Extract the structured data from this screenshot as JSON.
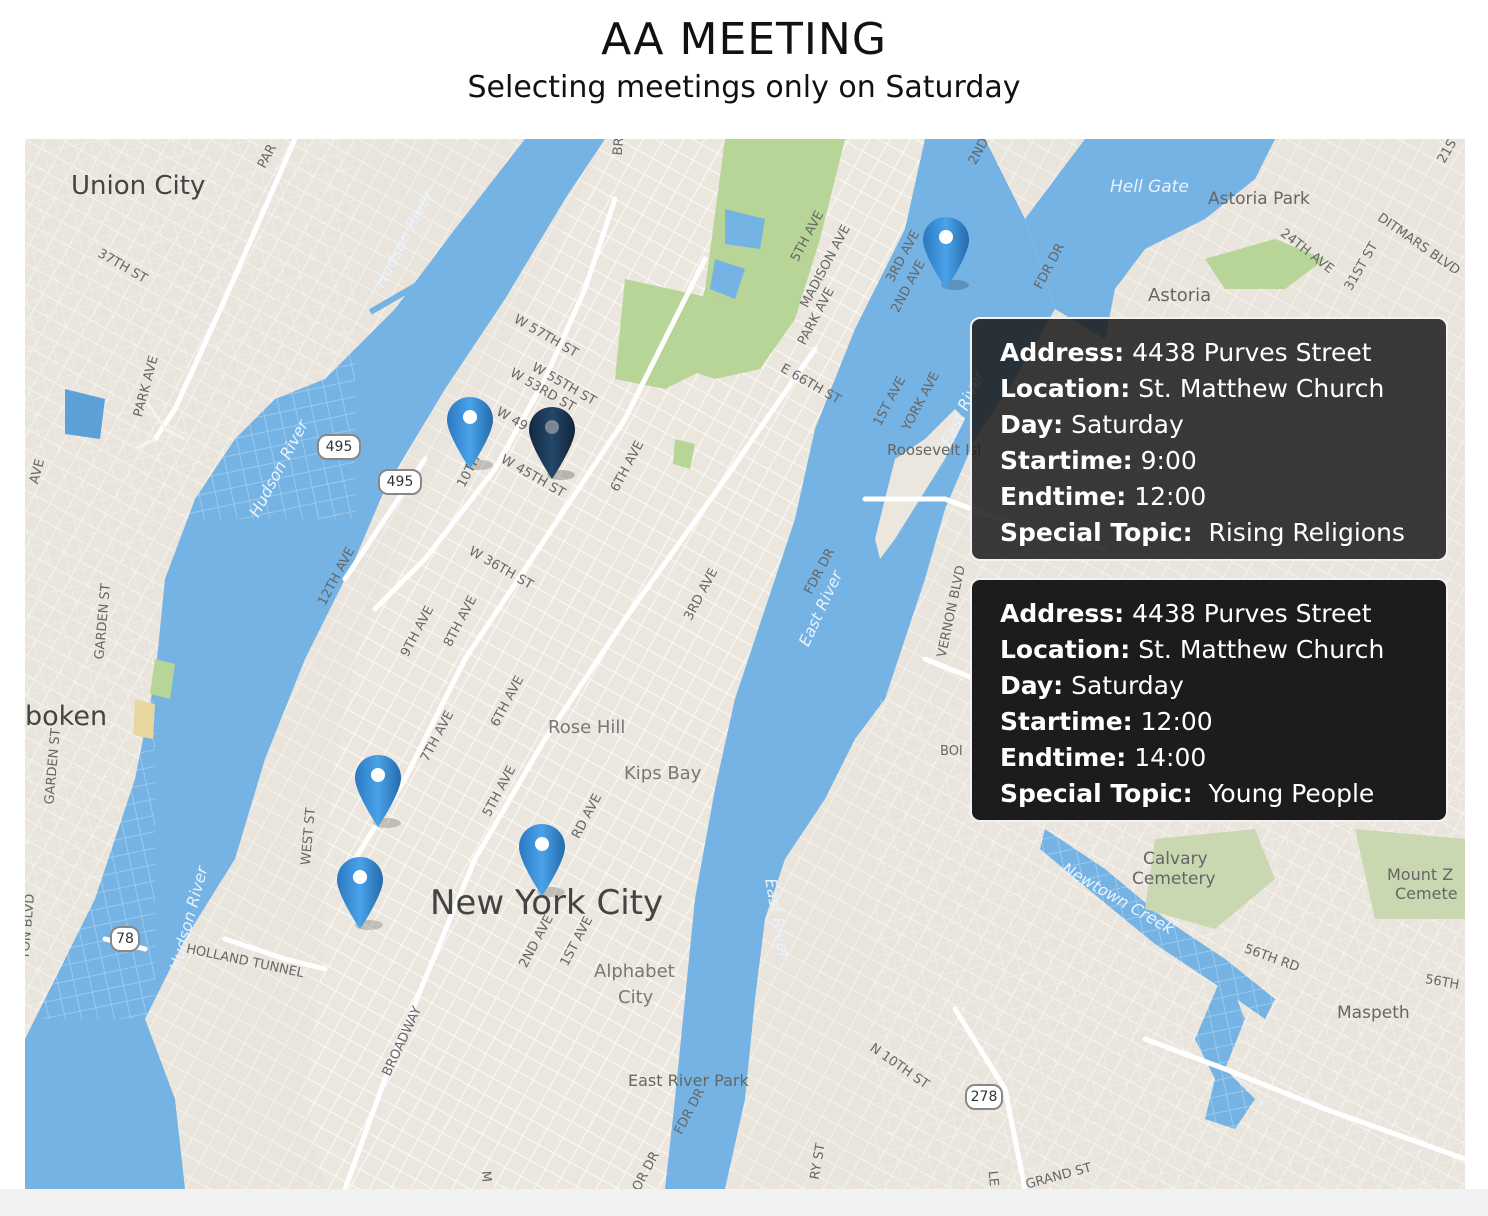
{
  "header": {
    "title": "AA MEETING",
    "subtitle": "Selecting meetings only on Saturday"
  },
  "map": {
    "place_labels": {
      "union_city": "Union City",
      "hoboken": "boken",
      "new_york_city": "New York City",
      "astoria": "Astoria",
      "astoria_park": "Astoria Park",
      "hell_gate": "Hell Gate",
      "roosevelt_island": "Roosevelt Isl",
      "rose_hill": "Rose Hill",
      "kips_bay": "Kips Bay",
      "alphabet_city_1": "Alphabet",
      "alphabet_city_2": "City",
      "calvary_1": "Calvary",
      "calvary_2": "Cemetery",
      "mount_z_1": "Mount Z",
      "mount_z_2": "Cemete",
      "maspeth": "Maspeth",
      "east_river_park": "East River Park"
    },
    "water_labels": {
      "hudson_1": "Hudson River",
      "hudson_2": "Hudson River",
      "hudson_3": "Hudson River",
      "east_river_1": "East River",
      "east_river_2": "East River",
      "east_river_3": "East River",
      "newtown_creek": "Newtown Creek"
    },
    "street_labels": {
      "w57": "W 57TH ST",
      "w55": "W 55TH ST",
      "w53": "W 53RD ST",
      "w49": "W 49",
      "w45": "W 45TH ST",
      "w36": "W 36TH ST",
      "e66": "E 66TH ST",
      "fifth_ave": "5TH AVE",
      "madison": "MADISON AVE",
      "park": "PARK AVE",
      "third_ave": "3RD AVE",
      "second_ave": "2ND AVE",
      "first_ave": "1ST AVE",
      "york": "YORK AVE",
      "fdr": "FDR DR",
      "tenth": "10TH",
      "twelfth": "12TH AVE",
      "ninth": "9TH AVE",
      "eighth": "8TH AVE",
      "seventh": "7TH AVE",
      "sixth": "6TH AVE",
      "sixth_b": "6TH AVE",
      "fifth_b": "5TH AVE",
      "third_b": "3RD AVE",
      "second_b": "2ND AVE",
      "first_b": "1ST AVE",
      "west_st": "WEST ST",
      "broadway": "BROADWAY",
      "holland": "HOLLAND TUNNEL",
      "vernon": "VERNON BLVD",
      "n10": "N 10TH ST",
      "grand": "GRAND ST",
      "st56": "56TH RD",
      "ditmars": "DITMARS BLVD",
      "st24": "24TH AVE",
      "st31": "31ST ST",
      "st37": "37TH ST",
      "garden1": "GARDEN ST",
      "garden2": "GARDEN ST",
      "park_ave_nj": "PARK AVE",
      "ave_nj": "AVE",
      "br": "BR",
      "second_nd": "2ND",
      "ave_x": "AVE",
      "st56b": "56TH",
      "boi": "BOI",
      "rd_ave": "RD AVE",
      "ry_st": "RY ST",
      "ton_blvd": "TON BLVD",
      "lm": "M",
      "le": "LE",
      "st21": "21S",
      "sta": "S",
      "ga": "GA",
      "par": "PAR",
      "cor_dr": "OR DR",
      "fdr_b": "FDR DR"
    },
    "shields": {
      "i495_a": "495",
      "i495_b": "495",
      "i78": "78",
      "i278": "278"
    },
    "markers": [
      {
        "name": "marker-upper-east",
        "state": "default"
      },
      {
        "name": "marker-hells-kitchen",
        "state": "default"
      },
      {
        "name": "marker-times-square",
        "state": "selected"
      },
      {
        "name": "marker-chelsea",
        "state": "default"
      },
      {
        "name": "marker-west-village",
        "state": "default"
      },
      {
        "name": "marker-east-village",
        "state": "default"
      }
    ],
    "colors": {
      "water": "#74b3e3",
      "land": "#e9e4dc",
      "park": "#b7d596",
      "marker": "#3a8fd6",
      "marker_selected": "#1d3a57",
      "popup_bg": "#1c1c1c"
    }
  },
  "popups": [
    {
      "address_label": "Address:",
      "address": "4438 Purves Street",
      "location_label": "Location:",
      "location": "St. Matthew Church",
      "day_label": "Day:",
      "day": "Saturday",
      "start_label": "Startime:",
      "start": "9:00",
      "end_label": "Endtime:",
      "end": "12:00",
      "topic_label": "Special Topic:",
      "topic": "Rising Religions"
    },
    {
      "address_label": "Address:",
      "address": "4438 Purves Street",
      "location_label": "Location:",
      "location": "St. Matthew Church",
      "day_label": "Day:",
      "day": "Saturday",
      "start_label": "Startime:",
      "start": "12:00",
      "end_label": "Endtime:",
      "end": "14:00",
      "topic_label": "Special Topic:",
      "topic": "Young People"
    }
  ]
}
